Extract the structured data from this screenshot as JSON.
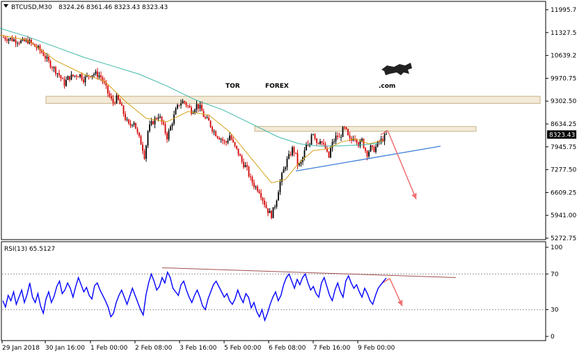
{
  "header": {
    "symbol": "BTCUSD,M30",
    "open": "8324.26",
    "high": "8361.46",
    "low": "8323.43",
    "close": "8323.43"
  },
  "watermark": {
    "part1": "TOR",
    "part2": "FOREX",
    "part3": ".com",
    "colors": {
      "tor": "#222222",
      "forex": "#e8401c",
      "com": "#222222"
    }
  },
  "rsi_label": "RSI(13) 65.5127",
  "colors": {
    "candle_up": "#000000",
    "candle_down": "#d40000",
    "ma_fast": "#d4a017",
    "ma_slow": "#3cb8a8",
    "trendline": "#3c7fd8",
    "rsi_line": "#0000ff",
    "rsi_trend": "#a05050",
    "arrow": "#f07070",
    "zone_fill": "#f3ead8",
    "zone_stroke": "#c8b48a",
    "price_tag_bg": "#000000"
  },
  "chart_data": [
    {
      "type": "candlestick",
      "title": "BTCUSD,M30",
      "current_price": 8323.43,
      "current_price_label": "8323.43",
      "ylim": [
        5272.75,
        11995.75
      ],
      "y_ticks": [
        "11995.75",
        "11327.50",
        "10639.25",
        "9970.75",
        "9302.50",
        "8634.25",
        "7945.75",
        "7277.50",
        "6609.25",
        "5941.00",
        "5272.75"
      ],
      "x_ticks": [
        "29 Jan 2018",
        "30 Jan 16:00",
        "1 Feb 00:00",
        "2 Feb 08:00",
        "3 Feb 16:00",
        "5 Feb 00:00",
        "6 Feb 08:00",
        "7 Feb 16:00",
        "9 Feb 00:00"
      ],
      "close_path": [
        [
          0,
          11200
        ],
        [
          12,
          11150
        ],
        [
          22,
          11100
        ],
        [
          32,
          11050
        ],
        [
          40,
          11080
        ],
        [
          48,
          10950
        ],
        [
          55,
          10850
        ],
        [
          62,
          10700
        ],
        [
          70,
          10450
        ],
        [
          78,
          10250
        ],
        [
          86,
          10050
        ],
        [
          92,
          9800
        ],
        [
          98,
          10000
        ],
        [
          106,
          10050
        ],
        [
          114,
          10100
        ],
        [
          120,
          9950
        ],
        [
          128,
          10080
        ],
        [
          136,
          10120
        ],
        [
          144,
          10050
        ],
        [
          150,
          9800
        ],
        [
          156,
          9500
        ],
        [
          162,
          9250
        ],
        [
          168,
          9400
        ],
        [
          174,
          9150
        ],
        [
          180,
          8800
        ],
        [
          186,
          8550
        ],
        [
          192,
          8750
        ],
        [
          198,
          8300
        ],
        [
          204,
          8000
        ],
        [
          208,
          7650
        ],
        [
          212,
          8400
        ],
        [
          216,
          8600
        ],
        [
          222,
          8750
        ],
        [
          228,
          8900
        ],
        [
          234,
          8600
        ],
        [
          240,
          8250
        ],
        [
          246,
          8600
        ],
        [
          252,
          9000
        ],
        [
          258,
          9250
        ],
        [
          264,
          9300
        ],
        [
          270,
          9150
        ],
        [
          276,
          9000
        ],
        [
          282,
          9200
        ],
        [
          288,
          9100
        ],
        [
          294,
          8800
        ],
        [
          300,
          8700
        ],
        [
          306,
          8450
        ],
        [
          312,
          8300
        ],
        [
          318,
          8200
        ],
        [
          324,
          8050
        ],
        [
          330,
          8300
        ],
        [
          336,
          8000
        ],
        [
          342,
          7800
        ],
        [
          348,
          7500
        ],
        [
          354,
          7350
        ],
        [
          360,
          7000
        ],
        [
          366,
          6800
        ],
        [
          372,
          6700
        ],
        [
          378,
          6400
        ],
        [
          384,
          6100
        ],
        [
          390,
          5950
        ],
        [
          396,
          6300
        ],
        [
          400,
          6700
        ],
        [
          404,
          7050
        ],
        [
          408,
          7300
        ],
        [
          412,
          7550
        ],
        [
          416,
          7700
        ],
        [
          420,
          7900
        ],
        [
          424,
          7800
        ],
        [
          428,
          7400
        ],
        [
          432,
          7450
        ],
        [
          436,
          7700
        ],
        [
          440,
          8000
        ],
        [
          444,
          7900
        ],
        [
          448,
          8450
        ],
        [
          452,
          8300
        ],
        [
          456,
          8050
        ],
        [
          460,
          8200
        ],
        [
          464,
          8000
        ],
        [
          468,
          7900
        ],
        [
          472,
          7600
        ],
        [
          476,
          8000
        ],
        [
          480,
          8150
        ],
        [
          484,
          8300
        ],
        [
          488,
          8200
        ],
        [
          492,
          8450
        ],
        [
          496,
          8500
        ],
        [
          500,
          8250
        ],
        [
          504,
          8100
        ],
        [
          508,
          8300
        ],
        [
          512,
          8200
        ],
        [
          516,
          8000
        ],
        [
          520,
          8150
        ],
        [
          524,
          7900
        ],
        [
          528,
          7750
        ],
        [
          532,
          7950
        ],
        [
          536,
          7850
        ],
        [
          540,
          7950
        ],
        [
          544,
          8100
        ],
        [
          548,
          8150
        ],
        [
          552,
          8250
        ],
        [
          556,
          8323
        ]
      ],
      "ma_fast_path": [
        [
          0,
          11250
        ],
        [
          40,
          11100
        ],
        [
          80,
          10500
        ],
        [
          120,
          10100
        ],
        [
          150,
          9900
        ],
        [
          180,
          9300
        ],
        [
          210,
          8800
        ],
        [
          240,
          8700
        ],
        [
          270,
          9000
        ],
        [
          300,
          8900
        ],
        [
          330,
          8400
        ],
        [
          360,
          7650
        ],
        [
          390,
          6900
        ],
        [
          410,
          7000
        ],
        [
          430,
          7500
        ],
        [
          450,
          7850
        ],
        [
          470,
          7900
        ],
        [
          490,
          8100
        ],
        [
          510,
          8200
        ],
        [
          530,
          8050
        ],
        [
          550,
          8150
        ]
      ],
      "ma_slow_path": [
        [
          0,
          11450
        ],
        [
          40,
          11200
        ],
        [
          80,
          10900
        ],
        [
          120,
          10600
        ],
        [
          160,
          10350
        ],
        [
          200,
          10100
        ],
        [
          240,
          9750
        ],
        [
          280,
          9350
        ],
        [
          320,
          9050
        ],
        [
          360,
          8650
        ],
        [
          400,
          8250
        ],
        [
          430,
          8050
        ],
        [
          460,
          7980
        ],
        [
          490,
          7990
        ],
        [
          520,
          8020
        ],
        [
          550,
          8080
        ]
      ],
      "resistance_zones": [
        {
          "x": [
            66,
            776
          ],
          "y": [
            9240,
            9450
          ]
        },
        {
          "x": [
            366,
            684
          ],
          "y": [
            8420,
            8560
          ]
        }
      ],
      "support_trendline": {
        "from": [
          425,
          7250
        ],
        "to": [
          633,
          7980
        ]
      },
      "forecast_arrow": {
        "from": [
          557,
          8440
        ],
        "to": [
          598,
          6420
        ]
      }
    },
    {
      "type": "line",
      "title": "RSI(13) 65.5127",
      "current_value": 65.5127,
      "ylim": [
        0,
        100
      ],
      "y_ticks": [
        "100",
        "70",
        "30",
        "0"
      ],
      "levels": [
        70,
        30
      ],
      "values": [
        40,
        33,
        46,
        40,
        50,
        36,
        44,
        52,
        38,
        47,
        60,
        44,
        38,
        48,
        34,
        26,
        42,
        50,
        38,
        45,
        56,
        62,
        48,
        52,
        60,
        54,
        44,
        56,
        66,
        58,
        50,
        55,
        46,
        42,
        57,
        60,
        52,
        46,
        40,
        33,
        22,
        26,
        38,
        46,
        52,
        44,
        36,
        45,
        54,
        46,
        38,
        30,
        24,
        46,
        60,
        70,
        62,
        52,
        56,
        66,
        60,
        72,
        66,
        54,
        50,
        46,
        58,
        62,
        52,
        44,
        38,
        46,
        52,
        44,
        34,
        30,
        42,
        50,
        58,
        62,
        56,
        50,
        44,
        48,
        40,
        36,
        42,
        52,
        44,
        38,
        48,
        44,
        32,
        38,
        28,
        22,
        30,
        18,
        26,
        36,
        44,
        50,
        40,
        46,
        58,
        66,
        70,
        62,
        54,
        64,
        58,
        66,
        70,
        60,
        52,
        56,
        48,
        44,
        60,
        66,
        56,
        46,
        40,
        52,
        60,
        50,
        44,
        62,
        68,
        60,
        54,
        58,
        50,
        44,
        54,
        48,
        40,
        36,
        46,
        54,
        58,
        62,
        65.5
      ],
      "trendline": {
        "from": [
          233,
          77
        ],
        "to": [
          655,
          66
        ]
      },
      "forecast_arrow": {
        "from": [
          560,
          65
        ],
        "to": [
          578,
          34
        ]
      }
    }
  ]
}
